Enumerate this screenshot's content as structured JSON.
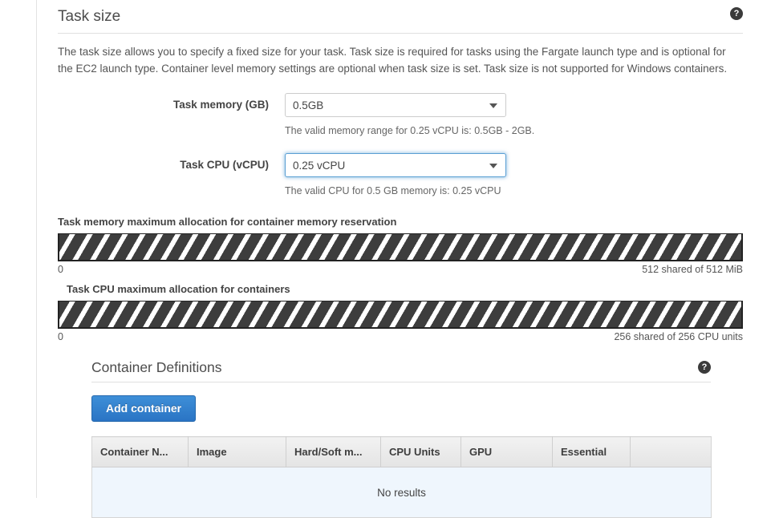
{
  "task_size": {
    "title": "Task size",
    "help_icon": "help-circle-icon",
    "description": "The task size allows you to specify a fixed size for your task. Task size is required for tasks using the Fargate launch type and is optional for the EC2 launch type. Container level memory settings are optional when task size is set. Task size is not supported for Windows containers.",
    "memory": {
      "label": "Task memory (GB)",
      "value": "0.5GB",
      "hint": "The valid memory range for 0.25 vCPU is: 0.5GB - 2GB."
    },
    "cpu": {
      "label": "Task CPU (vCPU)",
      "value": "0.25 vCPU",
      "hint": "The valid CPU for 0.5 GB memory is: 0.25 vCPU"
    },
    "memory_allocation": {
      "title": "Task memory maximum allocation for container memory reservation",
      "axis_min": "0",
      "axis_max": "512 shared of 512 MiB"
    },
    "cpu_allocation": {
      "title": "Task CPU maximum allocation for containers",
      "axis_min": "0",
      "axis_max": "256 shared of 256 CPU units"
    }
  },
  "container_definitions": {
    "title": "Container Definitions",
    "help_icon": "help-circle-icon",
    "add_button": "Add container",
    "columns": [
      "Container N...",
      "Image",
      "Hard/Soft m...",
      "CPU Units",
      "GPU",
      "Essential",
      ""
    ],
    "empty_message": "No results"
  },
  "colors": {
    "accent_blue": "#2a74c4",
    "focus_blue": "#5a9fd4",
    "stripe_dark": "#3d3d3d",
    "empty_row_bg": "#eff6fd"
  }
}
